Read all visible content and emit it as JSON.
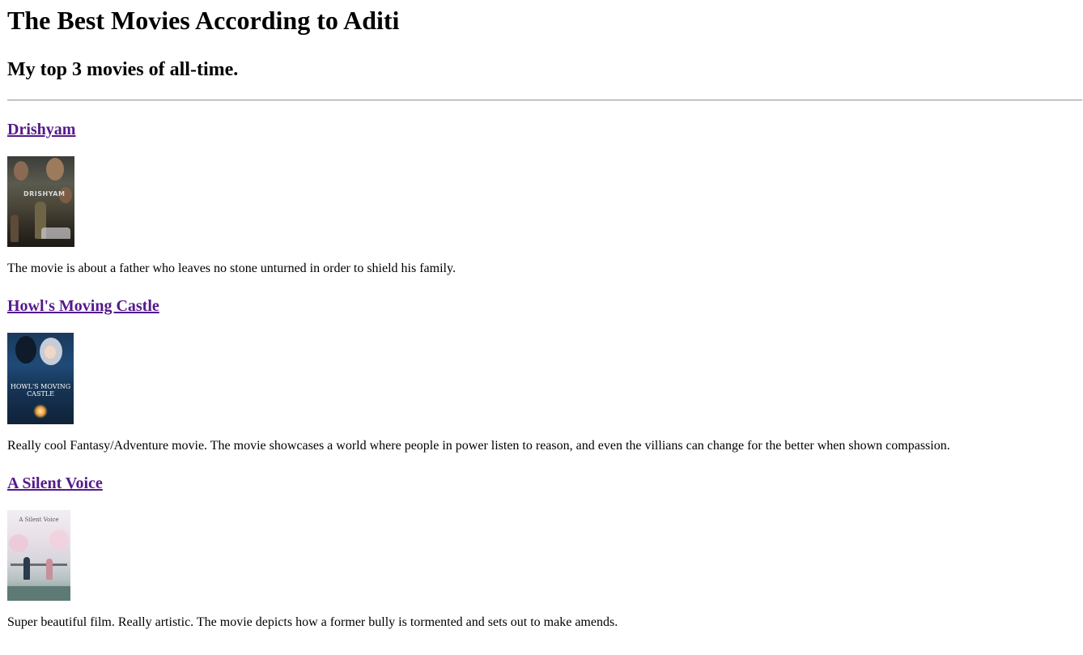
{
  "page": {
    "title": "The Best Movies According to Aditi",
    "subtitle": "My top 3 movies of all-time."
  },
  "movies": [
    {
      "title": "Drishyam",
      "poster_text": "DRISHYAM",
      "description": "The movie is about a father who leaves no stone unturned in order to shield his family."
    },
    {
      "title": "Howl's Moving Castle",
      "poster_text": "HOWL'S MOVING CASTLE",
      "description": "Really cool Fantasy/Adventure movie. The movie showcases a world where people in power listen to reason, and even the villians can change for the better when shown compassion."
    },
    {
      "title": "A Silent Voice",
      "poster_text": "A Silent Voice",
      "description": "Super beautiful film. Really artistic. The movie depicts how a former bully is tormented and sets out to make amends."
    }
  ],
  "colors": {
    "link_visited": "#551a8b",
    "text": "#000000",
    "background": "#ffffff"
  }
}
